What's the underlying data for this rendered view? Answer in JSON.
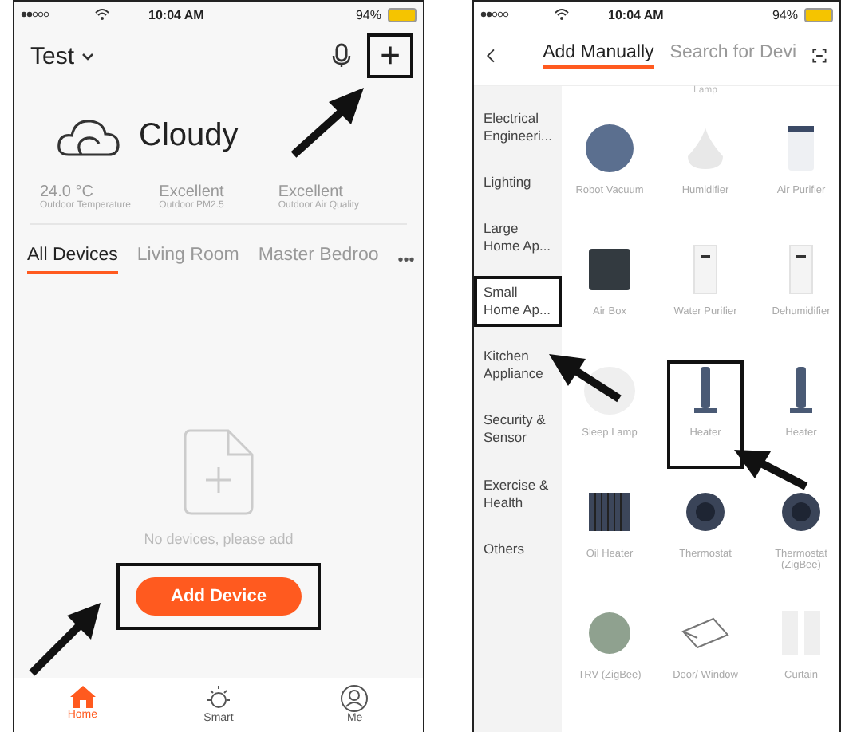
{
  "home_screen": {
    "status_bar": {
      "time": "10:04 AM",
      "battery": "94%"
    },
    "header": {
      "home_name": "Test",
      "add_button": "+",
      "add_highlighted": true
    },
    "weather": {
      "condition": "Cloudy",
      "stats": [
        {
          "value": "24.0 °C",
          "label": "Outdoor Temperature"
        },
        {
          "value": "Excellent",
          "label": "Outdoor PM2.5"
        },
        {
          "value": "Excellent",
          "label": "Outdoor Air Quality"
        }
      ]
    },
    "room_tabs": [
      {
        "label": "All Devices",
        "selected": true
      },
      {
        "label": "Living Room",
        "selected": false
      },
      {
        "label": "Master Bedroo",
        "selected": false
      }
    ],
    "more": "•••",
    "empty_message": "No devices, please add",
    "add_device_button": {
      "label": "Add Device",
      "highlighted": true
    },
    "nav": [
      {
        "label": "Home",
        "kind": "home",
        "selected": true
      },
      {
        "label": "Smart",
        "kind": "smart",
        "selected": false
      },
      {
        "label": "Me",
        "kind": "me",
        "selected": false
      }
    ]
  },
  "add_screen": {
    "status_bar": {
      "time": "10:04 AM",
      "battery": "94%"
    },
    "tabs": [
      {
        "label": "Add Manually",
        "selected": true
      },
      {
        "label": "Search for Devi",
        "selected": false
      }
    ],
    "categories": [
      {
        "label": "Electrical Engineeri...",
        "selected": false,
        "highlighted": false
      },
      {
        "label": "Lighting",
        "selected": false,
        "highlighted": false
      },
      {
        "label": "Large Home Ap...",
        "selected": false,
        "highlighted": false
      },
      {
        "label": "Small Home Ap...",
        "selected": true,
        "highlighted": true
      },
      {
        "label": "Kitchen Appliance",
        "selected": false,
        "highlighted": false
      },
      {
        "label": "Security & Sensor",
        "selected": false,
        "highlighted": false
      },
      {
        "label": "Exercise & Health",
        "selected": false,
        "highlighted": false
      },
      {
        "label": "Others",
        "selected": false,
        "highlighted": false
      }
    ],
    "partial_label": "Lamp",
    "devices": [
      {
        "label": "Robot Vacuum",
        "kind": "vacuum",
        "highlighted": false
      },
      {
        "label": "Humidifier",
        "kind": "humidifier",
        "highlighted": false
      },
      {
        "label": "Air Purifier",
        "kind": "purifier",
        "highlighted": false
      },
      {
        "label": "Air Box",
        "kind": "box",
        "highlighted": false
      },
      {
        "label": "Water Purifier",
        "kind": "tower",
        "highlighted": false
      },
      {
        "label": "Dehumidifier",
        "kind": "tower",
        "highlighted": false
      },
      {
        "label": "Sleep Lamp",
        "kind": "lamp",
        "highlighted": false
      },
      {
        "label": "Heater",
        "kind": "heater",
        "highlighted": true
      },
      {
        "label": "Heater",
        "kind": "heater",
        "highlighted": false
      },
      {
        "label": "Oil Heater",
        "kind": "radiator",
        "highlighted": false
      },
      {
        "label": "Thermostat",
        "kind": "thermostat",
        "highlighted": false
      },
      {
        "label": "Thermostat (ZigBee)",
        "kind": "thermostat",
        "highlighted": false
      },
      {
        "label": "TRV (ZigBee)",
        "kind": "trv",
        "highlighted": false
      },
      {
        "label": "Door/ Window",
        "kind": "window",
        "highlighted": false
      },
      {
        "label": "Curtain",
        "kind": "curtain",
        "highlighted": false
      }
    ]
  }
}
